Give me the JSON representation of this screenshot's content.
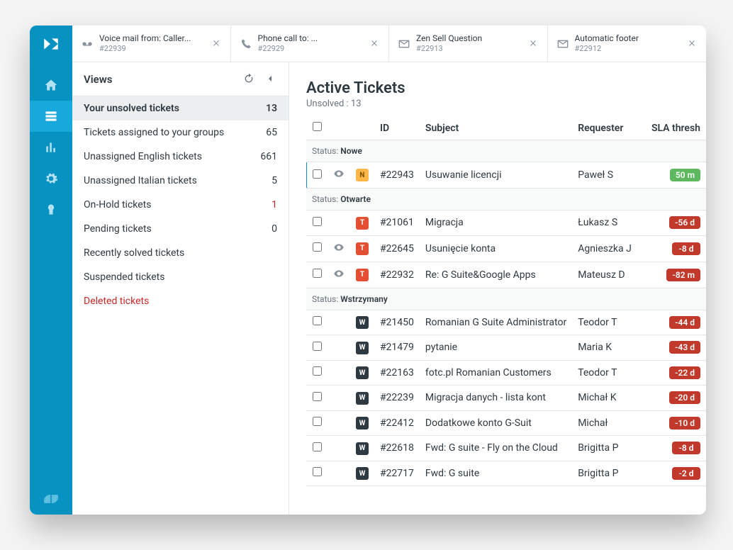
{
  "tabs": [
    {
      "icon": "voicemail",
      "title": "Voice mail from: Caller...",
      "sub": "#22939"
    },
    {
      "icon": "phone",
      "title": "Phone call to: ...",
      "sub": "#22929"
    },
    {
      "icon": "envelope",
      "title": "Zen Sell Question",
      "sub": "#22913"
    },
    {
      "icon": "envelope",
      "title": "Automatic footer",
      "sub": "#22912"
    }
  ],
  "views": {
    "header": "Views",
    "items": [
      {
        "label": "Your unsolved tickets",
        "count": "13",
        "selected": true
      },
      {
        "label": "Tickets assigned to your groups",
        "count": "65"
      },
      {
        "label": "Unassigned English tickets",
        "count": "661"
      },
      {
        "label": "Unassigned Italian tickets",
        "count": "5"
      },
      {
        "label": "On-Hold tickets",
        "count": "1",
        "count_red": true
      },
      {
        "label": "Pending tickets",
        "count": "0"
      },
      {
        "label": "Recently solved tickets",
        "count": ""
      },
      {
        "label": "Suspended tickets",
        "count": ""
      },
      {
        "label": "Deleted tickets",
        "count": "",
        "red": true
      }
    ]
  },
  "panel": {
    "title": "Active Tickets",
    "subtitle": "Unsolved  : 13",
    "columns": {
      "id": "ID",
      "subject": "Subject",
      "requester": "Requester",
      "sla": "SLA thresh"
    },
    "status_label": "Status:",
    "groups": [
      {
        "status": "Nowe",
        "rows": [
          {
            "indicator": true,
            "eye": true,
            "badge": "N",
            "id": "#22943",
            "subject": "Usuwanie licencji",
            "requester": "Paweł S",
            "sla": "50 m",
            "sla_color": "green"
          }
        ]
      },
      {
        "status": "Otwarte",
        "rows": [
          {
            "badge": "T",
            "id": "#21061",
            "subject": "Migracja",
            "requester": "Łukasz S",
            "sla": "-56 d",
            "sla_color": "red"
          },
          {
            "eye": true,
            "badge": "T",
            "id": "#22645",
            "subject": "Usunięcie konta",
            "requester": "Agnieszka J",
            "sla": "-8 d",
            "sla_color": "red"
          },
          {
            "eye": true,
            "badge": "T",
            "id": "#22932",
            "subject": "Re: G Suite&Google Apps",
            "requester": "Mateusz D",
            "sla": "-82 m",
            "sla_color": "red"
          }
        ]
      },
      {
        "status": "Wstrzymany",
        "rows": [
          {
            "badge": "W",
            "id": "#21450",
            "subject": "Romanian G Suite Administrator",
            "requester": "Teodor T",
            "sla": "-44 d",
            "sla_color": "red"
          },
          {
            "badge": "W",
            "id": "#21479",
            "subject": "pytanie",
            "requester": "Maria K",
            "sla": "-43 d",
            "sla_color": "red"
          },
          {
            "badge": "W",
            "id": "#22163",
            "subject": "fotc.pl Romanian Customers",
            "requester": "Teodor T",
            "sla": "-22 d",
            "sla_color": "red"
          },
          {
            "badge": "W",
            "id": "#22239",
            "subject": "Migracja danych - lista kont",
            "requester": "Michał K",
            "sla": "-20 d",
            "sla_color": "red"
          },
          {
            "badge": "W",
            "id": "#22412",
            "subject": "Dodatkowe konto G-Suit",
            "requester": "Michał",
            "sla": "-10 d",
            "sla_color": "red"
          },
          {
            "badge": "W",
            "id": "#22618",
            "subject": "Fwd: G suite - Fly on the Cloud",
            "requester": "Brigitta P",
            "sla": "-8 d",
            "sla_color": "red"
          },
          {
            "badge": "W",
            "id": "#22717",
            "subject": "Fwd: G suite",
            "requester": "Brigitta P",
            "sla": "-2 d",
            "sla_color": "red"
          }
        ]
      }
    ]
  }
}
